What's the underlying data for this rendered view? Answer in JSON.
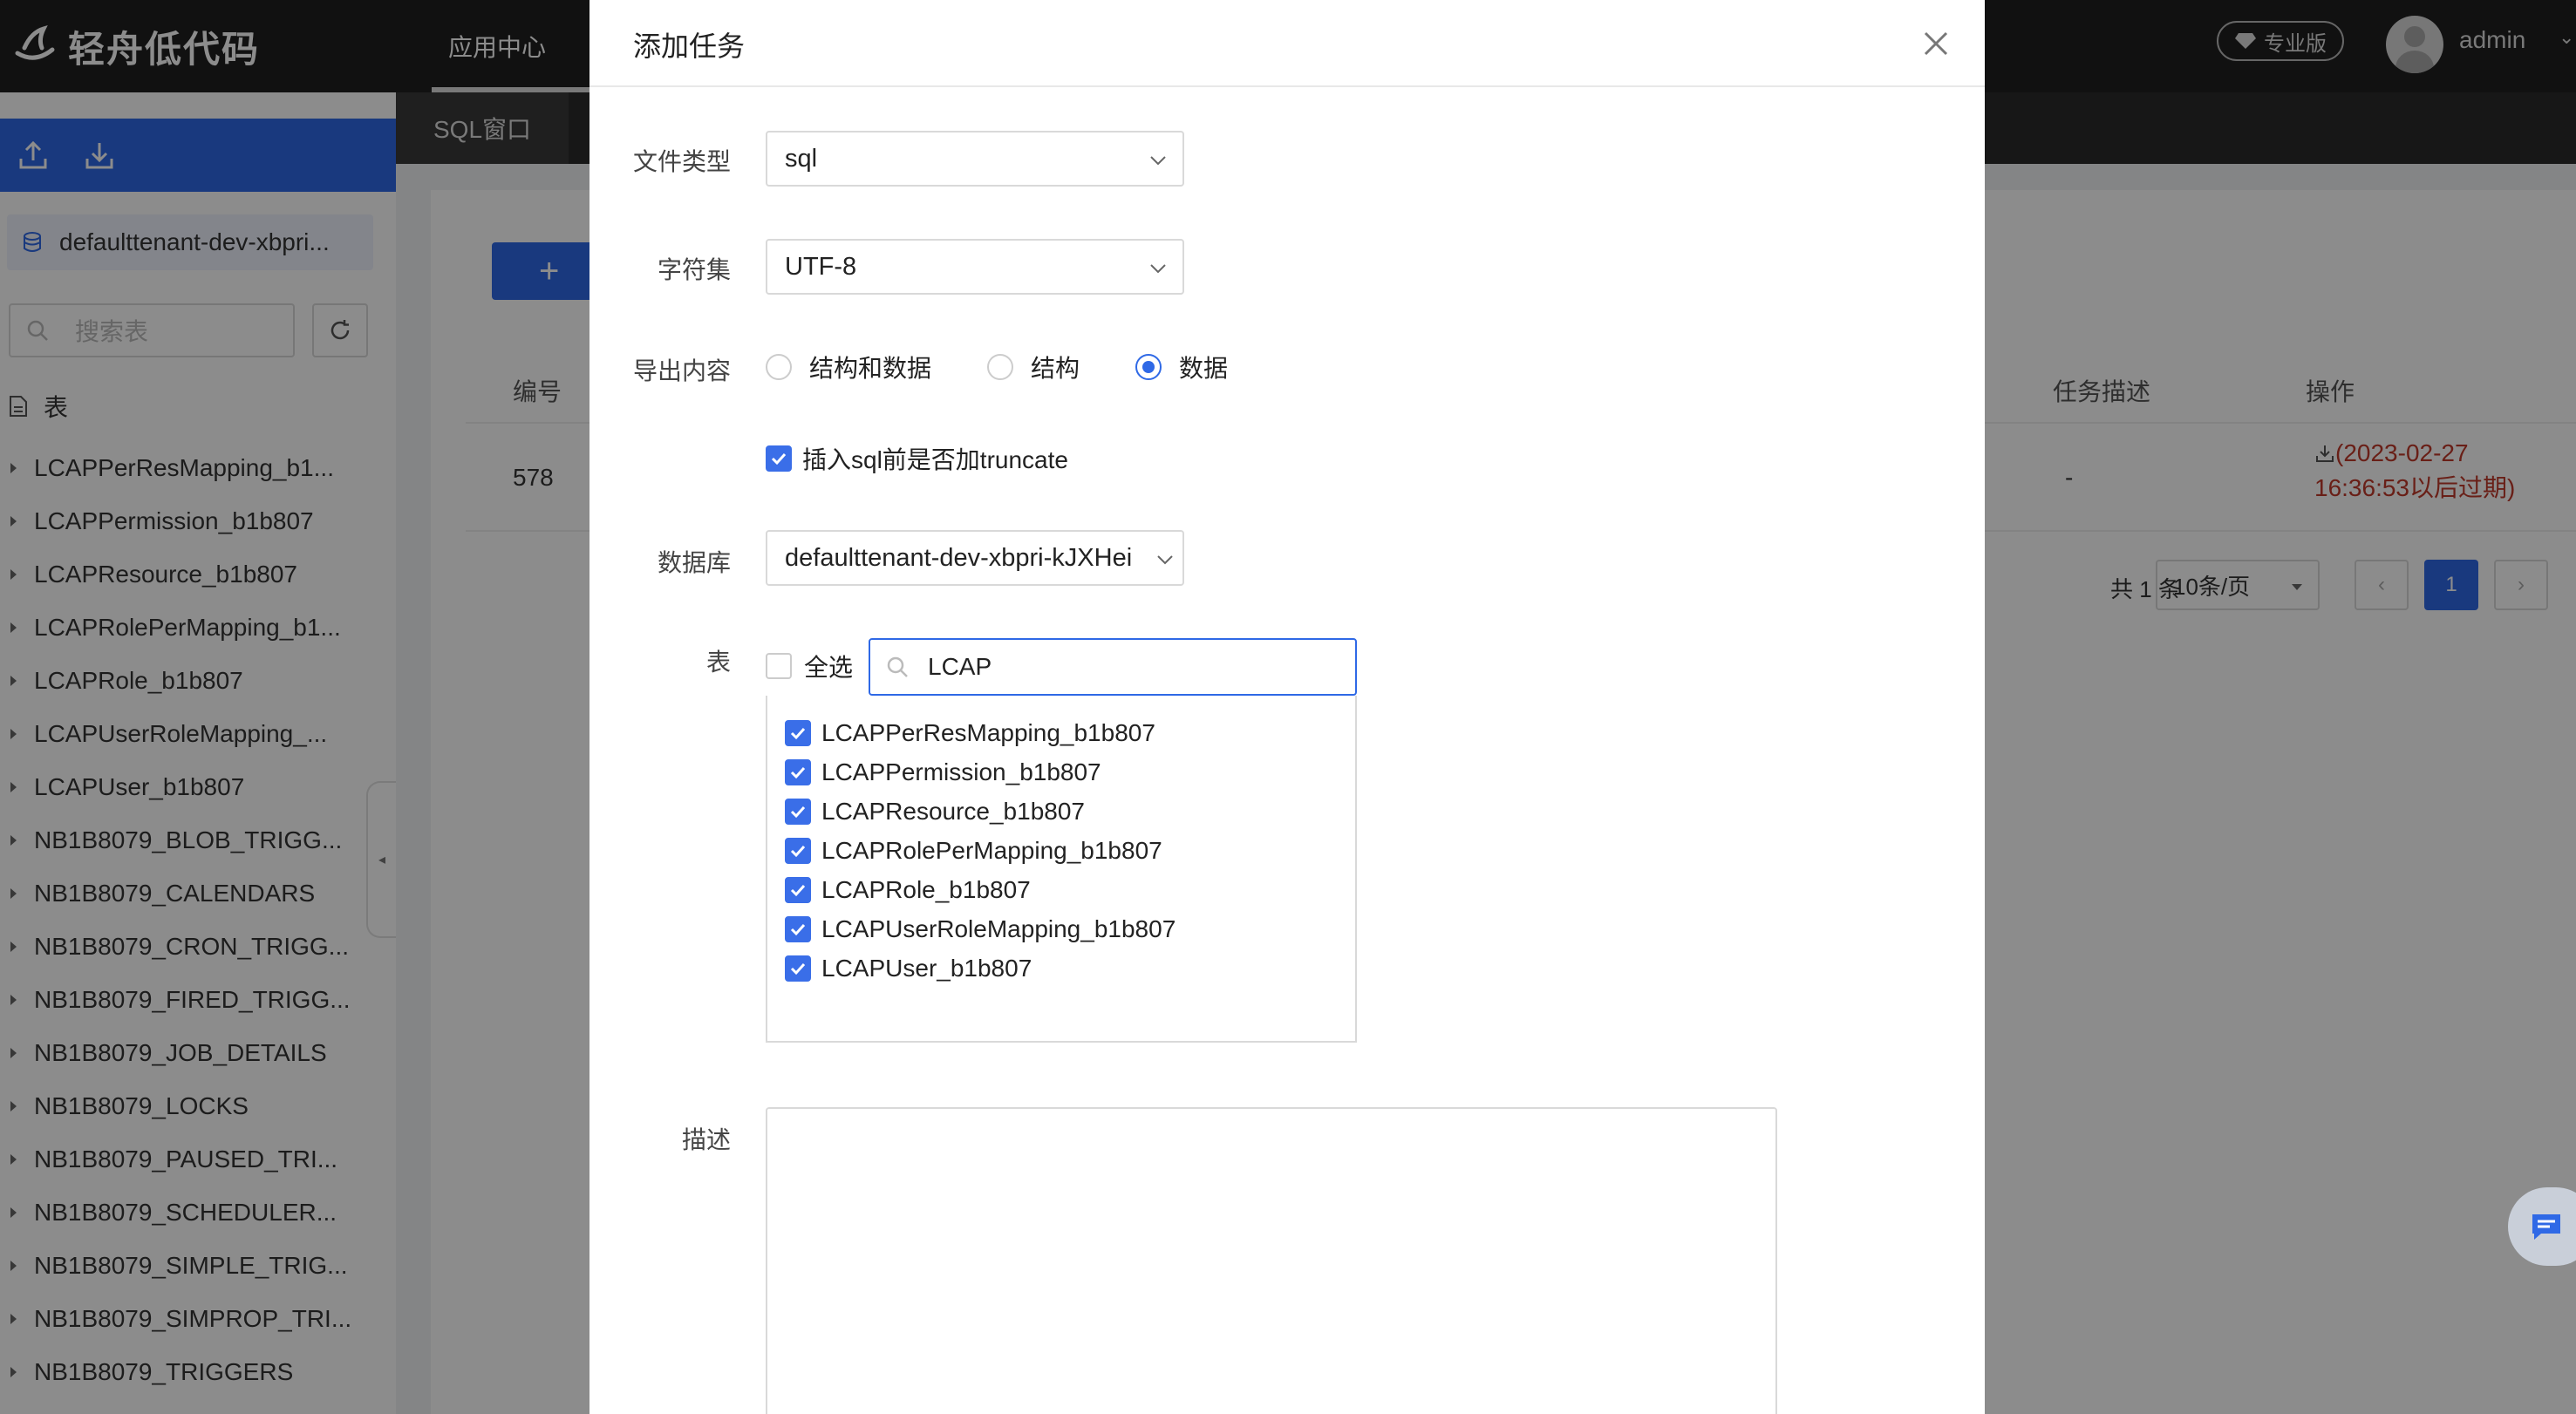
{
  "app": {
    "logo_text": "轻舟低代码",
    "nav_item": "应用中心",
    "pro_badge": "专业版",
    "user_name": "admin"
  },
  "tabs": {
    "sql_tab": "SQL窗口"
  },
  "sidebar": {
    "database": "defaulttenant-dev-xbpri...",
    "search_placeholder": "搜索表",
    "tables_heading": "表",
    "items": [
      "LCAPPerResMapping_b1...",
      "LCAPPermission_b1b807",
      "LCAPResource_b1b807",
      "LCAPRolePerMapping_b1...",
      "LCAPRole_b1b807",
      "LCAPUserRoleMapping_...",
      "LCAPUser_b1b807",
      "NB1B8079_BLOB_TRIGG...",
      "NB1B8079_CALENDARS",
      "NB1B8079_CRON_TRIGG...",
      "NB1B8079_FIRED_TRIGG...",
      "NB1B8079_JOB_DETAILS",
      "NB1B8079_LOCKS",
      "NB1B8079_PAUSED_TRI...",
      "NB1B8079_SCHEDULER...",
      "NB1B8079_SIMPLE_TRIG...",
      "NB1B8079_SIMPROP_TRI...",
      "NB1B8079_TRIGGERS"
    ]
  },
  "main": {
    "add_button": "+",
    "columns": {
      "id": "编号",
      "task_desc": "任务描述",
      "action": "操作"
    },
    "row": {
      "id": "578",
      "task_desc": "-",
      "action": "(2023-02-27 16:36:53以后过期)"
    },
    "pager": {
      "total": "共 1 条",
      "page_size": "10条/页",
      "current_page": "1",
      "prev": "‹",
      "next": "›"
    }
  },
  "modal": {
    "title": "添加任务",
    "file_type_label": "文件类型",
    "file_type_value": "sql",
    "charset_label": "字符集",
    "charset_value": "UTF-8",
    "export_label": "导出内容",
    "export_options": [
      {
        "label": "结构和数据",
        "checked": false
      },
      {
        "label": "结构",
        "checked": false
      },
      {
        "label": "数据",
        "checked": true
      }
    ],
    "truncate_label": "插入sql前是否加truncate",
    "database_label": "数据库",
    "database_value": "defaulttenant-dev-xbpri-kJXHei",
    "table_label": "表",
    "select_all_label": "全选",
    "table_search_value": "LCAP",
    "tables": [
      "LCAPPerResMapping_b1b807",
      "LCAPPermission_b1b807",
      "LCAPResource_b1b807",
      "LCAPRolePerMapping_b1b807",
      "LCAPRole_b1b807",
      "LCAPUserRoleMapping_b1b807",
      "LCAPUser_b1b807"
    ],
    "desc_label": "描述"
  },
  "colors": {
    "primary": "#2f69e6",
    "danger": "#c0392b",
    "topbar": "#1f1f1f"
  }
}
